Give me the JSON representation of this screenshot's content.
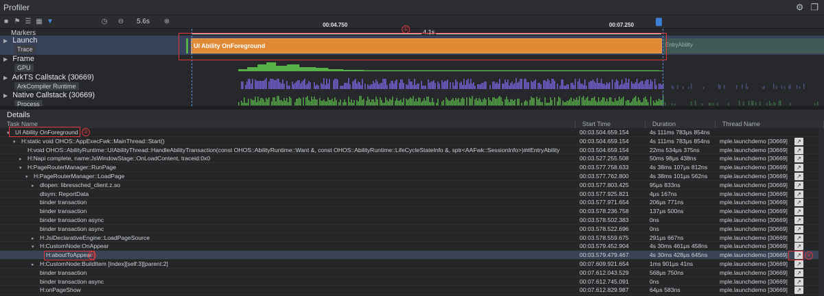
{
  "app": {
    "title": "Profiler"
  },
  "toolbar": {
    "zoom_value": "5.6s"
  },
  "ruler": {
    "ticks": [
      "00:04.750",
      "00:07.250"
    ]
  },
  "tracks": {
    "markers_label": "Markers",
    "launch": {
      "name": "Launch",
      "sub": "Trace",
      "bar_label": "UI Ability OnForeground",
      "ghost_label": "EntryAbility",
      "range_label": "4.1s"
    },
    "frame": {
      "name": "Frame",
      "sub": "GPU"
    },
    "arkts": {
      "name": "ArkTS Callstack (30669)",
      "sub": "ArkCompiler Runtime"
    },
    "native": {
      "name": "Native Callstack (30669)",
      "sub": "Process"
    }
  },
  "annotations": [
    "①",
    "②",
    "③",
    "④"
  ],
  "details": {
    "title": "Details",
    "columns": [
      "Task Name",
      "Start Time",
      "Duration",
      "Thread Name"
    ],
    "rows": [
      {
        "indent": 0,
        "arrow": "▾",
        "name": "UI Ability OnForeground",
        "start": "00:03.504.659.154",
        "duration": "4s 111ms 783μs 854ns",
        "thread": ""
      },
      {
        "indent": 1,
        "arrow": "▾",
        "name": "H:static void OHOS::AppExecFwk::MainThread::Start()",
        "start": "00:03.504.659.154",
        "duration": "4s 111ms 783μs 854ns",
        "thread": "mple.launchdemo [30669]"
      },
      {
        "indent": 2,
        "arrow": "",
        "name": "H:void OHOS::AbilityRuntime::UIAbilityThread::HandleAbilityTransaction(const OHOS::AbilityRuntime::Want &, const OHOS::AbilityRuntime::LifeCycleStateInfo &, sptr<AAFwk::SessionInfo>)##EntryAbility",
        "start": "00:03.504.659.154",
        "duration": "22ms 534μs 375ns",
        "thread": "mple.launchdemo [30669]"
      },
      {
        "indent": 2,
        "arrow": "▸",
        "name": "H:Napi complete, name:JsWindowStage::OnLoadContent, traceid:0x0",
        "start": "00:03.527.255.508",
        "duration": "50ms 98μs 438ns",
        "thread": "mple.launchdemo [30669]"
      },
      {
        "indent": 2,
        "arrow": "▾",
        "name": "H:PageRouterManager::RunPage",
        "start": "00:03.577.758.633",
        "duration": "4s 38ms 107μs 812ns",
        "thread": "mple.launchdemo [30669]"
      },
      {
        "indent": 3,
        "arrow": "▾",
        "name": "H:PageRouterManager::LoadPage",
        "start": "00:03.577.762.800",
        "duration": "4s 38ms 101μs 562ns",
        "thread": "mple.launchdemo [30669]"
      },
      {
        "indent": 4,
        "arrow": "▸",
        "name": "dlopen: libressched_client.z.so",
        "start": "00:03.577.803.425",
        "duration": "95μs 833ns",
        "thread": "mple.launchdemo [30669]"
      },
      {
        "indent": 4,
        "arrow": "",
        "name": "dlsym: ReportData",
        "start": "00:03.577.925.821",
        "duration": "4μs 167ns",
        "thread": "mple.launchdemo [30669]"
      },
      {
        "indent": 4,
        "arrow": "",
        "name": "binder transaction",
        "start": "00:03.577.971.654",
        "duration": "206μs 771ns",
        "thread": "mple.launchdemo [30669]"
      },
      {
        "indent": 4,
        "arrow": "",
        "name": "binder transaction",
        "start": "00:03.578.236.758",
        "duration": "137μs 500ns",
        "thread": "mple.launchdemo [30669]"
      },
      {
        "indent": 4,
        "arrow": "",
        "name": "binder transaction async",
        "start": "00:03.578.502.383",
        "duration": "0ns",
        "thread": "mple.launchdemo [30669]"
      },
      {
        "indent": 4,
        "arrow": "",
        "name": "binder transaction async",
        "start": "00:03.578.522.696",
        "duration": "0ns",
        "thread": "mple.launchdemo [30669]"
      },
      {
        "indent": 4,
        "arrow": "▸",
        "name": "H:JsiDeclarativeEngine::LoadPageSource",
        "start": "00:03.578.559.675",
        "duration": "291μs 667ns",
        "thread": "mple.launchdemo [30669]"
      },
      {
        "indent": 4,
        "arrow": "▾",
        "name": "H:CustomNode:OnAppear",
        "start": "00:03.579.452.904",
        "duration": "4s 30ms 461μs 458ns",
        "thread": "mple.launchdemo [30669]"
      },
      {
        "indent": 5,
        "arrow": "",
        "name": "H:aboutToAppear",
        "start": "00:03.579.479.467",
        "duration": "4s 30ms 428μs 645ns",
        "thread": "mple.launchdemo [30669]",
        "selected": true
      },
      {
        "indent": 4,
        "arrow": "▸",
        "name": "H:CustomNode:BuildItem [Index][self:3][parent:2]",
        "start": "00:07.609.921.654",
        "duration": "1ms 901μs 41ns",
        "thread": "mple.launchdemo [30669]"
      },
      {
        "indent": 4,
        "arrow": "",
        "name": "binder transaction",
        "start": "00:07.612.043.529",
        "duration": "568μs 750ns",
        "thread": "mple.launchdemo [30669]"
      },
      {
        "indent": 4,
        "arrow": "",
        "name": "binder transaction async",
        "start": "00:07.612.745.091",
        "duration": "0ns",
        "thread": "mple.launchdemo [30669]"
      },
      {
        "indent": 4,
        "arrow": "",
        "name": "H:onPageShow",
        "start": "00:07.612.829.987",
        "duration": "64μs 583ns",
        "thread": "mple.launchdemo [30669]"
      }
    ]
  },
  "colors": {
    "launch_bar": "#e08a35",
    "frame_gpu": "#57b148",
    "arkts": "#7766e0",
    "native": "#57b148",
    "annotation": "#e0383e"
  }
}
